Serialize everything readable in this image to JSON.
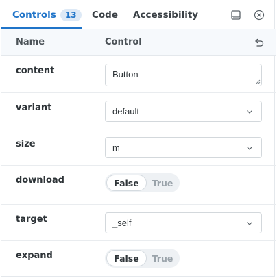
{
  "tabs": [
    {
      "label": "Controls",
      "badge": "13"
    },
    {
      "label": "Code"
    },
    {
      "label": "Accessibility"
    }
  ],
  "header": {
    "name": "Name",
    "control": "Control"
  },
  "rows": {
    "content": {
      "label": "content",
      "value": "Button"
    },
    "variant": {
      "label": "variant",
      "value": "default"
    },
    "size": {
      "label": "size",
      "value": "m"
    },
    "download": {
      "label": "download",
      "on": "False",
      "off": "True"
    },
    "target": {
      "label": "target",
      "value": "_self"
    },
    "expand": {
      "label": "expand",
      "on": "False",
      "off": "True"
    }
  },
  "icons": {
    "panel": "panel-bottom-icon",
    "close": "close-circle-icon",
    "reset": "undo-icon",
    "chevron": "chevron-down-icon"
  },
  "colors": {
    "accent": "#1f74c9",
    "badge_bg": "#dde9f6",
    "header_bg": "#f6f9fc"
  }
}
